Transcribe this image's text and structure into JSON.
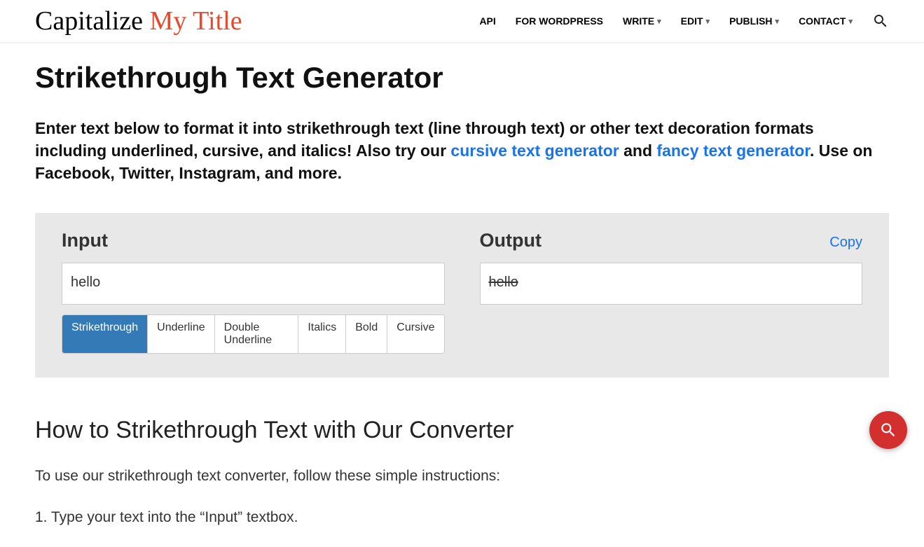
{
  "logo": {
    "part1": "Capitalize",
    "part2": "My Title"
  },
  "nav": {
    "api": "API",
    "wordpress": "FOR WORDPRESS",
    "write": "WRITE",
    "edit": "EDIT",
    "publish": "PUBLISH",
    "contact": "CONTACT"
  },
  "page_title": "Strikethrough Text Generator",
  "intro": {
    "text1": "Enter text below to format it into strikethrough text (line through text) or other text decoration formats including underlined, cursive, and italics! Also try our ",
    "link1": "cursive text generator",
    "text2": " and ",
    "link2": "fancy text generator",
    "text3": ". Use on Facebook, Twitter, Instagram, and more."
  },
  "tool": {
    "input_label": "Input",
    "output_label": "Output",
    "copy_label": "Copy",
    "input_value": "hello",
    "output_value": "hello ",
    "buttons": {
      "strikethrough": "Strikethrough",
      "underline": "Underline",
      "double_underline": "Double Underline",
      "italics": "Italics",
      "bold": "Bold",
      "cursive": "Cursive"
    }
  },
  "howto": {
    "title": "How to Strikethrough Text with Our Converter",
    "intro": "To use our strikethrough text converter, follow these simple instructions:",
    "step1": "1. Type your text into the “Input” textbox."
  }
}
